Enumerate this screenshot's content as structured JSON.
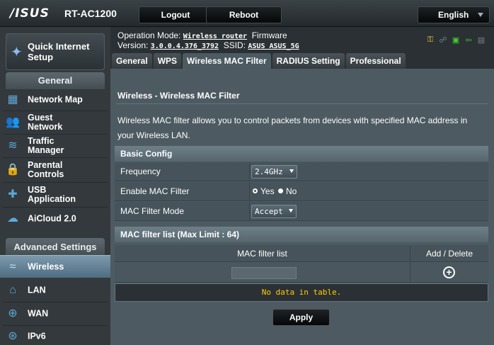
{
  "brand": {
    "logo": "/ISUS",
    "model": "RT-AC1200"
  },
  "topbar": {
    "logout": "Logout",
    "reboot": "Reboot",
    "language": "English"
  },
  "sidebar": {
    "quick_setup": "Quick Internet Setup",
    "general_header": "General",
    "general_items": [
      {
        "label": "Network Map",
        "icon": "network-map-icon"
      },
      {
        "label": "Guest Network",
        "icon": "guest-network-icon"
      },
      {
        "label": "Traffic Manager",
        "icon": "traffic-manager-icon"
      },
      {
        "label": "Parental Controls",
        "icon": "parental-controls-icon"
      },
      {
        "label": "USB Application",
        "icon": "usb-icon"
      },
      {
        "label": "AiCloud 2.0",
        "icon": "aicloud-icon"
      }
    ],
    "advanced_header": "Advanced Settings",
    "advanced_items": [
      {
        "label": "Wireless",
        "icon": "wifi-icon",
        "selected": true
      },
      {
        "label": "LAN",
        "icon": "home-icon"
      },
      {
        "label": "WAN",
        "icon": "globe-icon"
      },
      {
        "label": "IPv6",
        "icon": "ipv6-icon"
      }
    ]
  },
  "info": {
    "op_mode_label": "Operation Mode:",
    "op_mode_value": "Wireless router",
    "firmware_label": "Firmware",
    "version_label": "Version:",
    "version_value": "3.0.0.4.376_3792",
    "ssid_label": "SSID:",
    "ssid_value": "ASUS ASUS_5G"
  },
  "tabs": [
    {
      "label": "General"
    },
    {
      "label": "WPS"
    },
    {
      "label": "Wireless MAC Filter",
      "active": true
    },
    {
      "label": "RADIUS Setting"
    },
    {
      "label": "Professional"
    }
  ],
  "content": {
    "title": "Wireless - Wireless MAC Filter",
    "description": "Wireless MAC filter allows you to control packets from devices with specified MAC address in your Wireless LAN.",
    "basic_config_header": "Basic Config",
    "frequency_label": "Frequency",
    "frequency_value": "2.4GHz",
    "enable_label": "Enable MAC Filter",
    "enable_yes": "Yes",
    "enable_no": "No",
    "enable_value": "No",
    "mode_label": "MAC Filter Mode",
    "mode_value": "Accept",
    "list_header": "MAC filter list (Max Limit : 64)",
    "col_list": "MAC filter list",
    "col_action": "Add / Delete",
    "mac_input_value": "",
    "no_data": "No data in table.",
    "apply": "Apply"
  },
  "colors": {
    "no_data": "#ffcc00",
    "accent": "#5fa8d8"
  }
}
